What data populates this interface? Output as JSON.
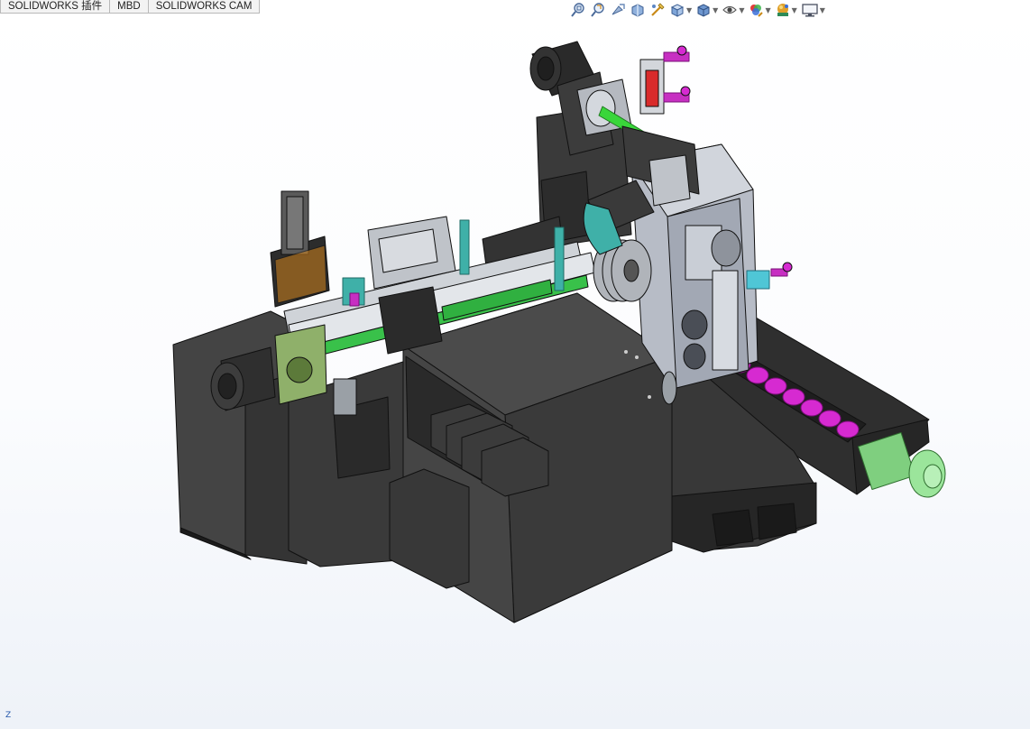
{
  "command_manager": {
    "tabs": [
      {
        "label": "SOLIDWORKS 插件"
      },
      {
        "label": "MBD"
      },
      {
        "label": "SOLIDWORKS CAM"
      }
    ]
  },
  "heads_up_toolbar": [
    {
      "icon": "zoom-to-fit-icon"
    },
    {
      "icon": "zoom-to-area-icon"
    },
    {
      "icon": "previous-view-icon"
    },
    {
      "icon": "section-view-icon"
    },
    {
      "icon": "dynamic-annotation-views-icon"
    },
    {
      "icon": "view-orientation-icon"
    },
    {
      "icon": "display-style-icon"
    },
    {
      "icon": "hide-show-items-icon"
    },
    {
      "icon": "edit-appearance-icon"
    },
    {
      "icon": "apply-scene-icon"
    },
    {
      "icon": "view-settings-icon"
    }
  ],
  "triad": {
    "axis_label": "Z"
  },
  "colors": {
    "machine_body": "#3e3e3e",
    "machine_body_dark": "#2a2a2a",
    "guard_grey": "#c8ccd2",
    "shaft_green": "#39d63a",
    "chip_conveyor_magenta": "#d62ad1",
    "motor_green": "#9be59b",
    "teal_part": "#3fb0a8",
    "cylinder_red": "#d92b2b"
  }
}
